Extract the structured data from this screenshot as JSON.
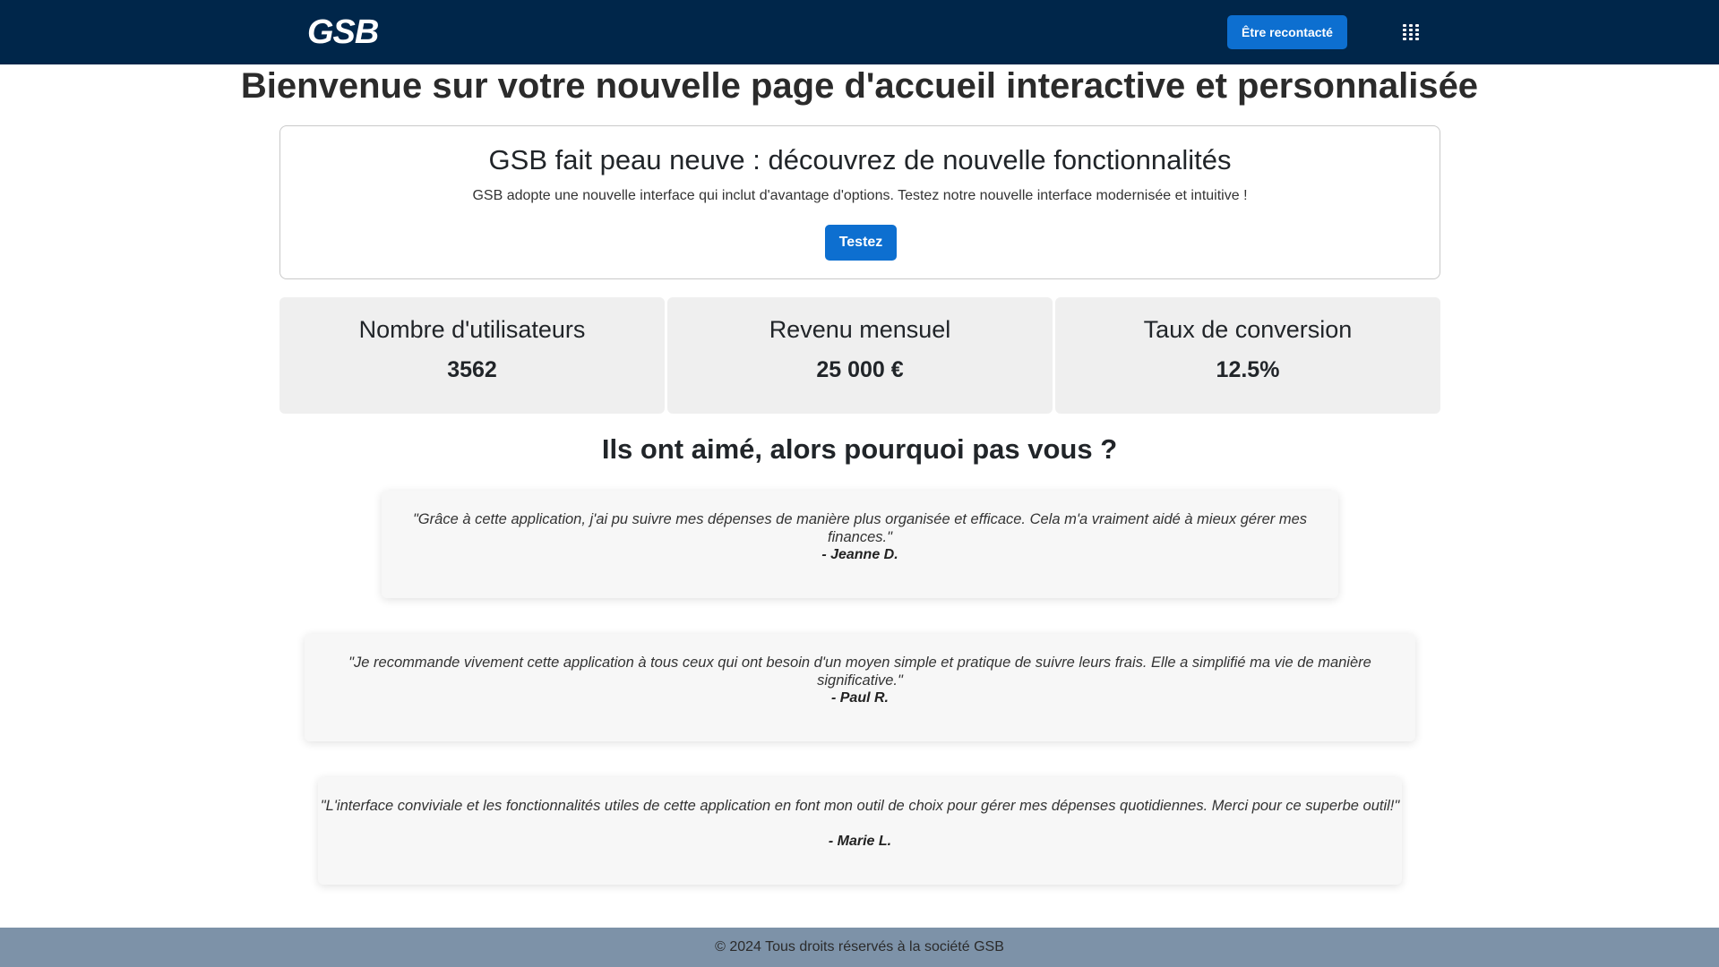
{
  "header": {
    "brand": "GSB",
    "contact_button": "Être recontacté",
    "apps_icon": "grid-dots-icon"
  },
  "main": {
    "title": "Bienvenue sur votre nouvelle page d'accueil interactive et personnalisée",
    "promo": {
      "title": "GSB fait peau neuve : découvrez de nouvelle fonctionnalités",
      "text": "GSB adopte une nouvelle interface qui inclut d'avantage d'options. Testez notre nouvelle interface modernisée et intuitive !",
      "button": "Testez"
    },
    "stats": [
      {
        "label": "Nombre d'utilisateurs",
        "value": "3562"
      },
      {
        "label": "Revenu mensuel",
        "value": "25 000 €"
      },
      {
        "label": "Taux de conversion",
        "value": "12.5%"
      }
    ],
    "testimonials_title": "Ils ont aimé, alors pourquoi pas vous ?",
    "testimonials": [
      {
        "quote": "\"Grâce à cette application, j'ai pu suivre mes dépenses de manière plus organisée et efficace. Cela m'a vraiment aidé à mieux gérer mes finances.\"",
        "author": "- Jeanne D."
      },
      {
        "quote": "\"Je recommande vivement cette application à tous ceux qui ont besoin d'un moyen simple et pratique de suivre leurs frais. Elle a simplifié ma vie de manière significative.\"",
        "author": "- Paul R."
      },
      {
        "quote": "\"L'interface conviviale et les fonctionnalités utiles de cette application en font mon outil de choix pour gérer mes dépenses quotidiennes. Merci pour ce superbe outil!\"",
        "author": "- Marie L."
      }
    ]
  },
  "footer": {
    "text": "© 2024 Tous droits réservés à la société GSB"
  },
  "colors": {
    "navbar": "#00264a",
    "accent": "#0d6fd0",
    "stat_bg": "#efefef",
    "footer": "#7d92a8"
  }
}
